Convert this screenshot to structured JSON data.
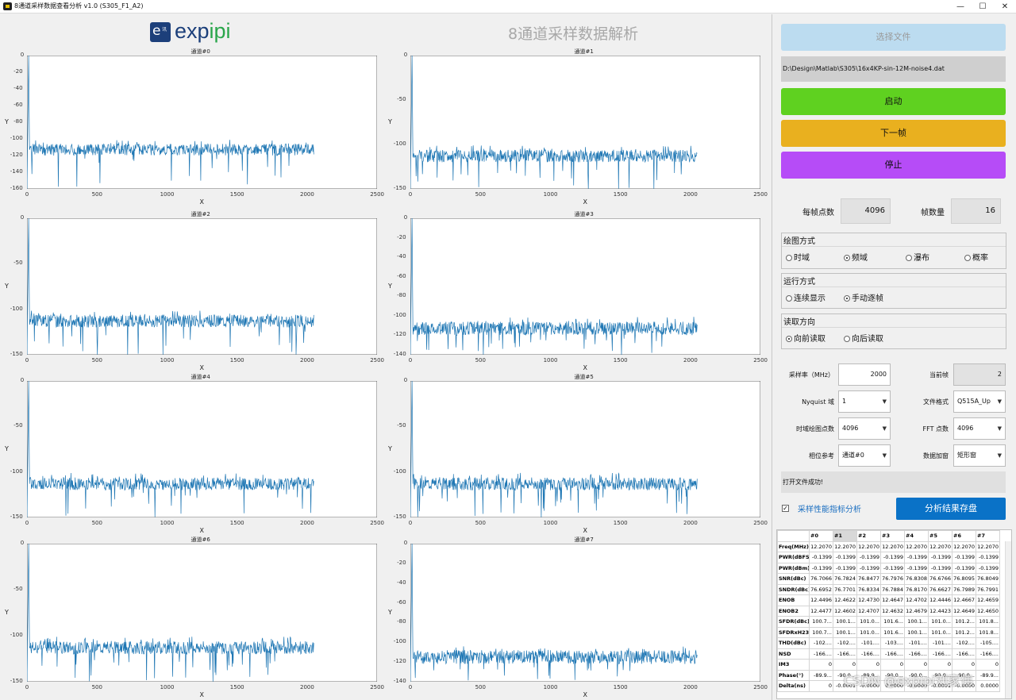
{
  "window": {
    "title": "8通道采样数据查看分析 v1.0 (S305_F1_A2)",
    "minimize": "—",
    "maximize": "☐",
    "close": "✕"
  },
  "header": {
    "logo_e": "e",
    "logo_small": "讯",
    "logo_a": "exp",
    "logo_b": "ipi",
    "title": "8通道采样数据解析"
  },
  "plot_toolbar": [
    "✎",
    "✐",
    "▭",
    "✋",
    "⊕",
    "⊖",
    "⌂"
  ],
  "chart_data": [
    {
      "type": "line",
      "title": "通道#0",
      "xlabel": "X",
      "ylabel": "Y",
      "xlim": [
        0,
        2500
      ],
      "ylim": [
        -160,
        0
      ],
      "xticks": [
        0,
        500,
        1000,
        1500,
        2000,
        2500
      ],
      "yticks": [
        0,
        -20,
        -40,
        -60,
        -80,
        -100,
        -120,
        -140,
        -160
      ],
      "baseline": -113,
      "spike_x": 12,
      "spike_y": 0,
      "seed": 1
    },
    {
      "type": "line",
      "title": "通道#1",
      "xlabel": "X",
      "ylabel": "Y",
      "xlim": [
        0,
        2500
      ],
      "ylim": [
        -150,
        0
      ],
      "xticks": [
        0,
        500,
        1000,
        1500,
        2000,
        2500
      ],
      "yticks": [
        0,
        -50,
        -100,
        -150
      ],
      "baseline": -113,
      "spike_x": 12,
      "spike_y": 0,
      "seed": 2
    },
    {
      "type": "line",
      "title": "通道#2",
      "xlabel": "X",
      "ylabel": "Y",
      "xlim": [
        0,
        2500
      ],
      "ylim": [
        -150,
        0
      ],
      "xticks": [
        0,
        500,
        1000,
        1500,
        2000,
        2500
      ],
      "yticks": [
        0,
        -50,
        -100,
        -150
      ],
      "baseline": -113,
      "spike_x": 12,
      "spike_y": 0,
      "seed": 3
    },
    {
      "type": "line",
      "title": "通道#3",
      "xlabel": "X",
      "ylabel": "Y",
      "xlim": [
        0,
        2500
      ],
      "ylim": [
        -140,
        0
      ],
      "xticks": [
        0,
        500,
        1000,
        1500,
        2000,
        2500
      ],
      "yticks": [
        0,
        -20,
        -40,
        -60,
        -80,
        -100,
        -120,
        -140
      ],
      "baseline": -113,
      "spike_x": 12,
      "spike_y": 0,
      "seed": 4
    },
    {
      "type": "line",
      "title": "通道#4",
      "xlabel": "X",
      "ylabel": "Y",
      "xlim": [
        0,
        2500
      ],
      "ylim": [
        -150,
        0
      ],
      "xticks": [
        0,
        500,
        1000,
        1500,
        2000,
        2500
      ],
      "yticks": [
        0,
        -50,
        -100,
        -150
      ],
      "baseline": -113,
      "spike_x": 12,
      "spike_y": 0,
      "seed": 5
    },
    {
      "type": "line",
      "title": "通道#5",
      "xlabel": "X",
      "ylabel": "Y",
      "xlim": [
        0,
        2500
      ],
      "ylim": [
        -150,
        0
      ],
      "xticks": [
        0,
        500,
        1000,
        1500,
        2000,
        2500
      ],
      "yticks": [
        0,
        -50,
        -100,
        -150
      ],
      "baseline": -113,
      "spike_x": 12,
      "spike_y": 0,
      "seed": 6
    },
    {
      "type": "line",
      "title": "通道#6",
      "xlabel": "X",
      "ylabel": "Y",
      "xlim": [
        0,
        2500
      ],
      "ylim": [
        -150,
        0
      ],
      "xticks": [
        0,
        500,
        1000,
        1500,
        2000,
        2500
      ],
      "yticks": [
        0,
        -50,
        -100,
        -150
      ],
      "baseline": -113,
      "spike_x": 12,
      "spike_y": 0,
      "seed": 7
    },
    {
      "type": "line",
      "title": "通道#7",
      "xlabel": "X",
      "ylabel": "Y",
      "xlim": [
        0,
        2500
      ],
      "ylim": [
        -140,
        0
      ],
      "xticks": [
        0,
        500,
        1000,
        1500,
        2000,
        2500
      ],
      "yticks": [
        0,
        -20,
        -40,
        -60,
        -80,
        -100,
        -120,
        -140
      ],
      "baseline": -115,
      "spike_x": 12,
      "spike_y": 0,
      "seed": 8
    }
  ],
  "controls": {
    "select_file": "选择文件",
    "file_path": "D:\\Design\\Matlab\\S305\\16x4KP-sin-12M-noise4.dat",
    "start": "启动",
    "next_frame": "下一帧",
    "stop": "停止",
    "points_per_frame_label": "每帧点数",
    "points_per_frame": "4096",
    "frame_count_label": "帧数量",
    "frame_count": "16",
    "plot_mode": {
      "title": "绘图方式",
      "options": [
        "时域",
        "频域",
        "瀑布",
        "概率"
      ],
      "selected": 1
    },
    "run_mode": {
      "title": "运行方式",
      "options": [
        "连续显示",
        "手动逐帧"
      ],
      "selected": 1
    },
    "read_dir": {
      "title": "读取方向",
      "options": [
        "向前读取",
        "向后读取"
      ],
      "selected": 0
    },
    "sample_rate_label": "采样率（MHz）",
    "sample_rate": "2000",
    "current_frame_label": "当前帧",
    "current_frame": "2",
    "nyquist_label": "Nyquist 域",
    "nyquist": "1",
    "file_format_label": "文件格式",
    "file_format": "Q515A_Up",
    "time_points_label": "时域绘图点数",
    "time_points": "4096",
    "fft_points_label": "FFT 点数",
    "fft_points": "4096",
    "phase_ref_label": "相位参考",
    "phase_ref": "通道#0",
    "window_label": "数据加窗",
    "window": "矩形窗",
    "status": "打开文件成功!",
    "perf_analysis": "采样性能指标分析",
    "save_results": "分析结果存盘"
  },
  "table": {
    "headers": [
      "",
      "#0",
      "#1",
      "#2",
      "#3",
      "#4",
      "#5",
      "#6",
      "#7"
    ],
    "rows": [
      [
        "Freq(MHz)",
        "12.2070",
        "12.2070",
        "12.2070",
        "12.2070",
        "12.2070",
        "12.2070",
        "12.2070",
        "12.2070"
      ],
      [
        "PWR(dBFS)",
        "-0.1399",
        "-0.1399",
        "-0.1399",
        "-0.1399",
        "-0.1399",
        "-0.1399",
        "-0.1399",
        "-0.1399"
      ],
      [
        "PWR(dBm)",
        "-0.1399",
        "-0.1399",
        "-0.1399",
        "-0.1399",
        "-0.1399",
        "-0.1399",
        "-0.1399",
        "-0.1399"
      ],
      [
        "SNR(dBc)",
        "76.7066",
        "76.7824",
        "76.8477",
        "76.7976",
        "76.8308",
        "76.6766",
        "76.8095",
        "76.8049"
      ],
      [
        "SNDR(dBc)",
        "76.6952",
        "76.7701",
        "76.8334",
        "76.7884",
        "76.8170",
        "76.6627",
        "76.7989",
        "76.7991"
      ],
      [
        "ENOB",
        "12.4496",
        "12.4622",
        "12.4730",
        "12.4647",
        "12.4702",
        "12.4446",
        "12.4667",
        "12.4659"
      ],
      [
        "ENOB2",
        "12.4477",
        "12.4602",
        "12.4707",
        "12.4632",
        "12.4679",
        "12.4423",
        "12.4649",
        "12.4650"
      ],
      [
        "SFDR(dBc)",
        "100.7...",
        "100.1...",
        "101.0...",
        "101.6...",
        "100.1...",
        "101.0...",
        "101.2...",
        "101.8..."
      ],
      [
        "SFDRxH23",
        "100.7...",
        "100.1...",
        "101.0...",
        "101.6...",
        "100.1...",
        "101.0...",
        "101.2...",
        "101.8..."
      ],
      [
        "THD(dBc)",
        "-102....",
        "-102....",
        "-101....",
        "-103....",
        "-101....",
        "-101....",
        "-102....",
        "-105...."
      ],
      [
        "NSD",
        "-166....",
        "-166....",
        "-166....",
        "-166....",
        "-166....",
        "-166....",
        "-166....",
        "-166...."
      ],
      [
        "IM3",
        "0",
        "0",
        "0",
        "0",
        "0",
        "0",
        "0",
        "0"
      ],
      [
        "Phase(°)",
        "-89.9...",
        "-90.0...",
        "-89.9...",
        "-90.0...",
        "-90.0...",
        "-90.0...",
        "-90.0...",
        "-89.9..."
      ],
      [
        "Delta(ns)",
        "0",
        "-0.0001",
        "-0.0000",
        "0.0000",
        "-0.0000",
        "-0.0001",
        "-0.0000",
        "0.0000"
      ]
    ]
  },
  "watermark": "CSDN @expipi刘家伟",
  "colors": {
    "start": "#5fd120",
    "next": "#e9b01f",
    "stop": "#b64cf7",
    "select": "#bcdcf0",
    "save": "#0a72c7",
    "trace": "#1f77b4"
  }
}
